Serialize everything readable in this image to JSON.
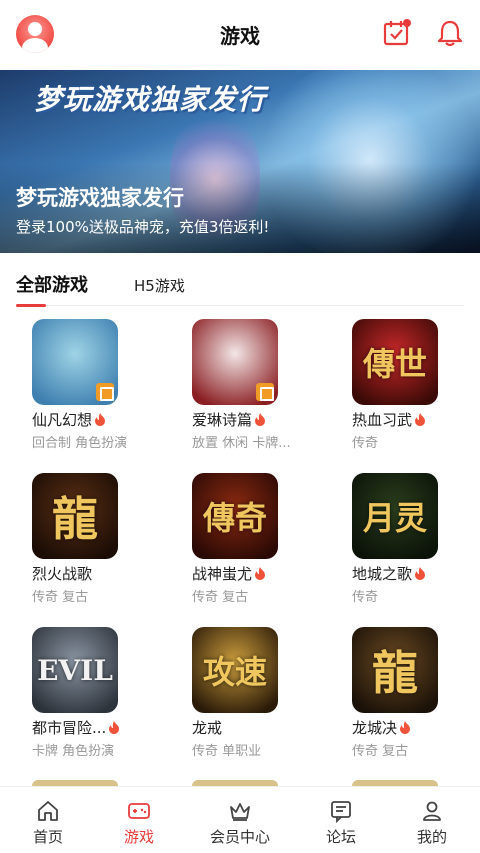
{
  "header": {
    "title": "游戏",
    "avatar_icon": "user-avatar-icon",
    "calendar_icon": "calendar-check-icon",
    "bell_icon": "bell-icon",
    "accent_color": "#e83c3c"
  },
  "banner": {
    "art_text": "梦玩游戏独家发行",
    "title": "梦玩游戏独家发行",
    "subtitle": "登录100%送极品神宠，充值3倍返利!"
  },
  "tabs": [
    {
      "label": "全部游戏",
      "active": true
    },
    {
      "label": "H5游戏",
      "active": false
    }
  ],
  "games": [
    {
      "name": "仙凡幻想",
      "tags": "回合制 角色扮演",
      "hot": true,
      "glyph": "",
      "icon_colors": [
        "#9fd4e6",
        "#3e7fb0"
      ]
    },
    {
      "name": "爱琳诗篇",
      "tags": "放置 休闲 卡牌...",
      "hot": true,
      "glyph": "",
      "icon_colors": [
        "#f3e6e6",
        "#8a1e22"
      ]
    },
    {
      "name": "热血习武",
      "tags": "传奇",
      "hot": true,
      "glyph": "傳世",
      "icon_colors": [
        "#c9282a",
        "#3a0a06"
      ]
    },
    {
      "name": "烈火战歌",
      "tags": "传奇 复古",
      "hot": false,
      "glyph": "龍",
      "icon_colors": [
        "#5a2f14",
        "#1a0c05"
      ]
    },
    {
      "name": "战神蚩尤",
      "tags": "传奇 复古",
      "hot": true,
      "glyph": "傳奇",
      "icon_colors": [
        "#8a2a10",
        "#2a0905"
      ]
    },
    {
      "name": "地城之歌",
      "tags": "传奇",
      "hot": true,
      "glyph": "月灵",
      "icon_colors": [
        "#2a3d1c",
        "#0b1208"
      ]
    },
    {
      "name": "都市冒险...",
      "tags": "卡牌 角色扮演",
      "hot": true,
      "glyph": "EVIL",
      "icon_colors": [
        "#8a95a2",
        "#2d333b"
      ]
    },
    {
      "name": "龙戒",
      "tags": "传奇 单职业",
      "hot": false,
      "glyph": "攻速",
      "icon_colors": [
        "#c99b3c",
        "#2a1a08"
      ]
    },
    {
      "name": "龙城决",
      "tags": "传奇 复古",
      "hot": true,
      "glyph": "龍",
      "icon_colors": [
        "#6b4a22",
        "#1a1108"
      ]
    }
  ],
  "bottom_nav": [
    {
      "label": "首页",
      "icon": "home-icon",
      "active": false
    },
    {
      "label": "游戏",
      "icon": "gamepad-icon",
      "active": true
    },
    {
      "label": "会员中心",
      "icon": "crown-icon",
      "active": false
    },
    {
      "label": "论坛",
      "icon": "forum-icon",
      "active": false
    },
    {
      "label": "我的",
      "icon": "profile-icon",
      "active": false
    }
  ]
}
